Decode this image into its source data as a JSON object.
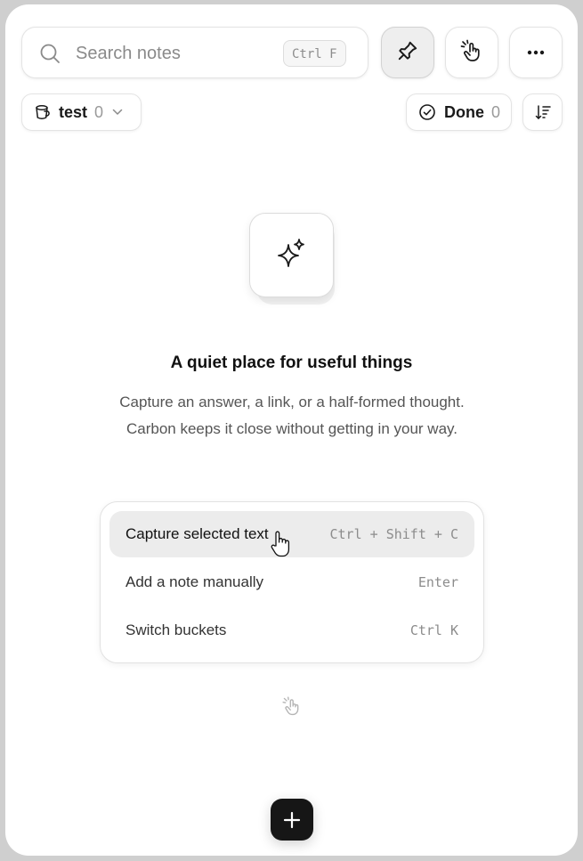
{
  "search": {
    "placeholder": "Search notes",
    "shortcut": "Ctrl F"
  },
  "toolbar": {
    "pin_icon": "pin-icon",
    "gesture_icon": "hand-pointer-sparkle-icon",
    "more_icon": "more-horizontal-icon"
  },
  "bucket": {
    "name": "test",
    "count": "0"
  },
  "done_filter": {
    "label": "Done",
    "count": "0"
  },
  "empty_state": {
    "icon": "sparkles-icon",
    "title": "A quiet place for useful things",
    "description": "Capture an answer, a link, or a half-formed thought. Carbon keeps it close without getting in your way."
  },
  "actions": [
    {
      "label": "Capture selected text",
      "shortcut": "Ctrl + Shift + C",
      "highlighted": true
    },
    {
      "label": "Add a note manually",
      "shortcut": "Enter",
      "highlighted": false
    },
    {
      "label": "Switch buckets",
      "shortcut": "Ctrl K",
      "highlighted": false
    }
  ],
  "colors": {
    "accent": "#161616",
    "highlight": "#ececec",
    "muted_text": "#8c8c8c"
  }
}
